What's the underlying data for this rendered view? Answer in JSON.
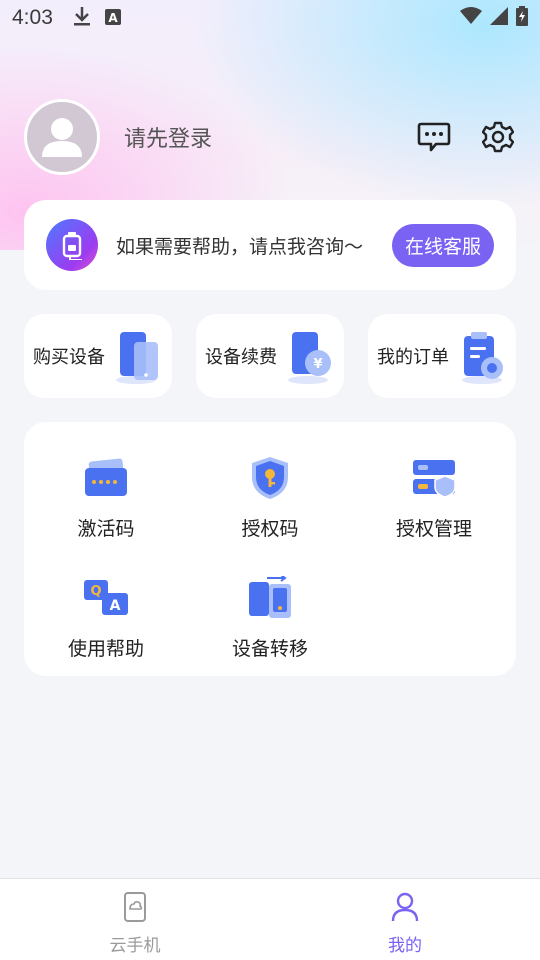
{
  "status_bar": {
    "time": "4:03",
    "left_icons": [
      "download-icon",
      "a-notification-icon"
    ],
    "right_icons": [
      "wifi-icon",
      "signal-icon",
      "battery-charging-icon"
    ]
  },
  "profile": {
    "login_prompt": "请先登录",
    "avatar_icon": "user-avatar-icon",
    "actions": [
      "message-icon",
      "settings-gear-icon"
    ]
  },
  "help": {
    "text": "如果需要帮助，请点我咨询～",
    "button": "在线客服"
  },
  "quick_actions": [
    {
      "label": "购买设备",
      "icon": "phone-purchase-icon"
    },
    {
      "label": "设备续费",
      "icon": "phone-renew-yen-icon"
    },
    {
      "label": "我的订单",
      "icon": "order-clipboard-icon"
    }
  ],
  "services": [
    {
      "label": "激活码",
      "icon": "activation-card-icon"
    },
    {
      "label": "授权码",
      "icon": "shield-key-icon"
    },
    {
      "label": "授权管理",
      "icon": "server-shield-icon"
    },
    {
      "label": "使用帮助",
      "icon": "qa-chat-icon"
    },
    {
      "label": "设备转移",
      "icon": "device-transfer-icon"
    }
  ],
  "tabs": [
    {
      "label": "云手机",
      "icon": "cloud-phone-icon",
      "active": false
    },
    {
      "label": "我的",
      "icon": "profile-icon",
      "active": true
    }
  ],
  "colors": {
    "accent": "#7a62f2",
    "icon_blue": "#4a72f0",
    "icon_yellow": "#f5b73b"
  }
}
